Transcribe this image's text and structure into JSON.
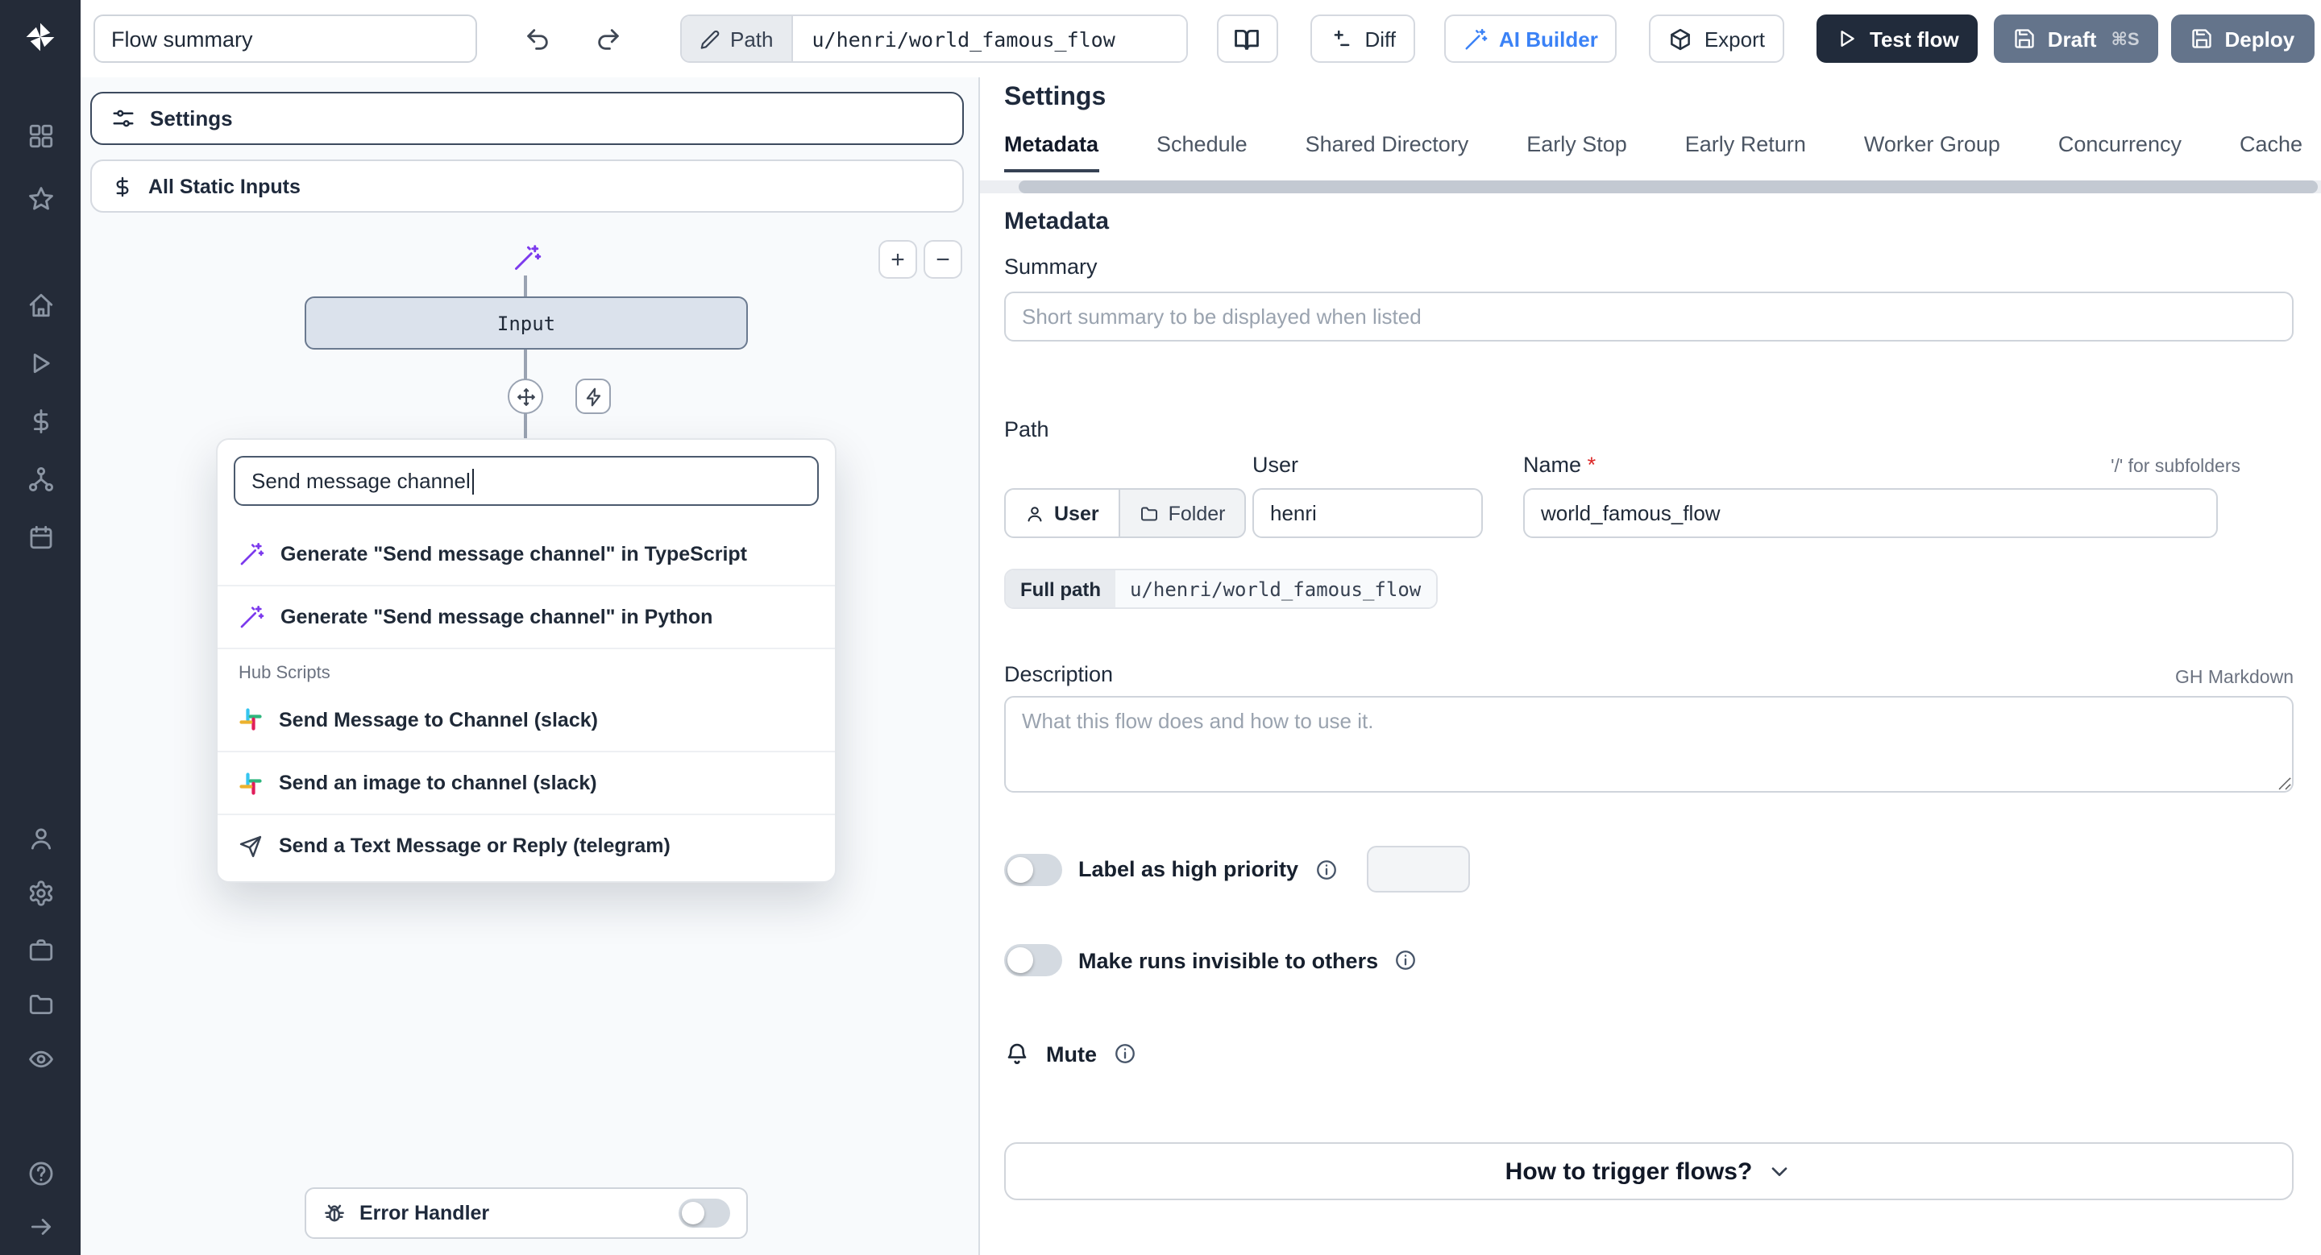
{
  "colors": {
    "sidebar_bg": "#242b38",
    "accent_blue": "#3b82f6",
    "dark_button": "#212b3b",
    "slate_button": "#64748b",
    "wand_purple": "#7c3aed",
    "required_red": "#dc2626",
    "canvas_bg": "#f8fafc"
  },
  "sidebar": {
    "icons": [
      "windmill-logo",
      "grid",
      "star",
      "home",
      "play",
      "dollar",
      "network",
      "calendar",
      "user",
      "gear",
      "briefcase",
      "folder",
      "eye",
      "help-circle",
      "arrow-right"
    ]
  },
  "topbar": {
    "summary_value": "Flow summary",
    "undo_icon": "undo-arrow",
    "redo_icon": "redo-arrow",
    "path_chip": "Path",
    "path_value": "u/henri/world_famous_flow",
    "diff": "Diff",
    "ai_builder": "AI Builder",
    "export": "Export",
    "test_flow": "Test flow",
    "draft": "Draft",
    "draft_shortcut": "⌘S",
    "deploy": "Deploy"
  },
  "flow": {
    "settings_box": "Settings",
    "static_inputs_box": "All Static Inputs",
    "input_node": "Input",
    "error_handler": "Error Handler",
    "zoom_in": "+",
    "zoom_out": "−",
    "search": {
      "query": "Send message channel",
      "results": [
        {
          "icon": "wand",
          "label": "Generate \"Send message channel\" in TypeScript"
        },
        {
          "icon": "wand",
          "label": "Generate \"Send message channel\" in Python"
        }
      ],
      "hub_section": "Hub Scripts",
      "hub_results": [
        {
          "icon": "slack",
          "label": "Send Message to Channel (slack)"
        },
        {
          "icon": "slack",
          "label": "Send an image to channel (slack)"
        },
        {
          "icon": "telegram",
          "label": "Send a Text Message or Reply (telegram)"
        }
      ]
    }
  },
  "settings": {
    "title": "Settings",
    "active_tab": "Metadata",
    "tabs": [
      "Metadata",
      "Schedule",
      "Shared Directory",
      "Early Stop",
      "Early Return",
      "Worker Group",
      "Concurrency",
      "Cache"
    ],
    "metadata": {
      "heading": "Metadata",
      "summary_label": "Summary",
      "summary_placeholder": "Short summary to be displayed when listed",
      "path_label": "Path",
      "owner_toggle": {
        "user": "User",
        "folder": "Folder"
      },
      "user_label": "User",
      "user_value": "henri",
      "name_label": "Name",
      "required_mark": "*",
      "name_value": "world_famous_flow",
      "subfolder_hint": "'/' for subfolders",
      "full_path_label": "Full path",
      "full_path_value": "u/henri/world_famous_flow",
      "description_label": "Description",
      "markdown_hint": "GH Markdown",
      "description_placeholder": "What this flow does and how to use it.",
      "high_priority_label": "Label as high priority",
      "invisible_runs_label": "Make runs invisible to others",
      "mute_label": "Mute",
      "trigger_question": "How to trigger flows?"
    }
  }
}
